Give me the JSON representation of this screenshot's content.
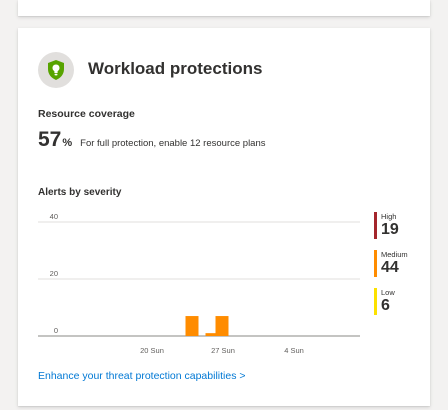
{
  "widget": {
    "title": "Workload protections",
    "icon": "shield-icon",
    "icon_color": "#57a300"
  },
  "resource_coverage": {
    "label": "Resource coverage",
    "percent": "57",
    "percent_sign": "%",
    "text": "For full protection, enable 12 resource plans"
  },
  "alerts": {
    "label": "Alerts by severity"
  },
  "chart_data": {
    "type": "bar",
    "title": "",
    "xlabel": "",
    "ylabel": "",
    "ylim": [
      0,
      40
    ],
    "y_ticks": [
      "40",
      "20",
      "0"
    ],
    "x_ticks": [
      "20 Sun",
      "27 Sun",
      "4 Sun"
    ],
    "series": [
      {
        "name": "Medium",
        "color": "#ff8c00",
        "bars": [
          {
            "day_offset_from_20_sun": 4,
            "value": 7
          },
          {
            "day_offset_from_20_sun": 6,
            "value": 1
          },
          {
            "day_offset_from_20_sun": 7,
            "value": 7
          }
        ]
      }
    ],
    "grid": true
  },
  "legend": [
    {
      "name": "High",
      "value": "19",
      "color": "#a4262c"
    },
    {
      "name": "Medium",
      "value": "44",
      "color": "#ff8c00"
    },
    {
      "name": "Low",
      "value": "6",
      "color": "#fce100"
    }
  ],
  "link_text": "Enhance your threat protection capabilities >"
}
